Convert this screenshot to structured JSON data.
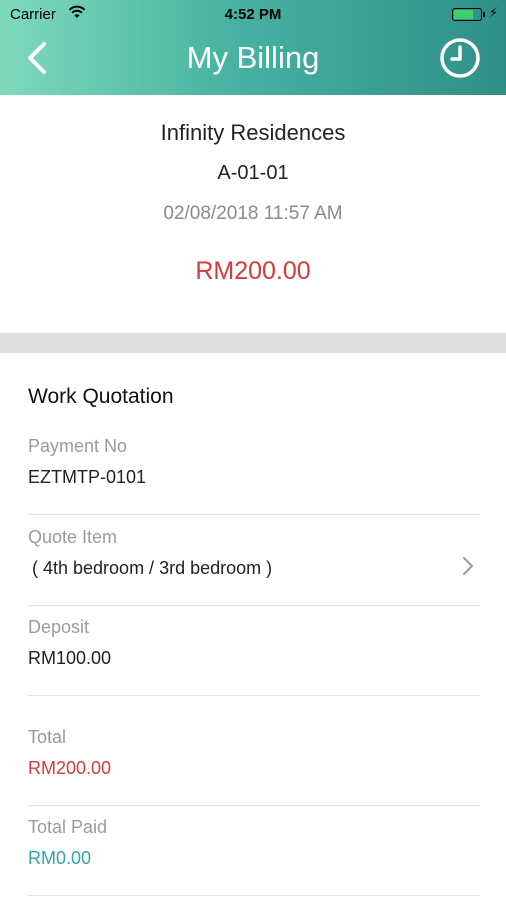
{
  "status_bar": {
    "carrier": "Carrier",
    "time": "4:52 PM"
  },
  "header": {
    "title": "My Billing"
  },
  "summary": {
    "property": "Infinity Residences",
    "unit": "A-01-01",
    "datetime": "02/08/2018 11:57 AM",
    "amount": "RM200.00"
  },
  "section": {
    "title": "Work Quotation"
  },
  "fields": {
    "payment_no": {
      "label": "Payment No",
      "value": "EZTMTP-0101"
    },
    "quote_item": {
      "label": "Quote Item",
      "value": "( 4th bedroom / 3rd bedroom )"
    },
    "deposit": {
      "label": "Deposit",
      "value": "RM100.00"
    },
    "total": {
      "label": "Total",
      "value": "RM200.00"
    },
    "total_paid": {
      "label": "Total Paid",
      "value": "RM0.00"
    }
  },
  "colors": {
    "header_start": "#7fd9bc",
    "header_end": "#2f8f88",
    "amount_red": "#d63a3a",
    "paid_teal": "#2fa7a3"
  },
  "icons": {
    "back": "chevron-left-icon",
    "history": "clock-icon",
    "quote_item": "chevron-right-icon"
  }
}
